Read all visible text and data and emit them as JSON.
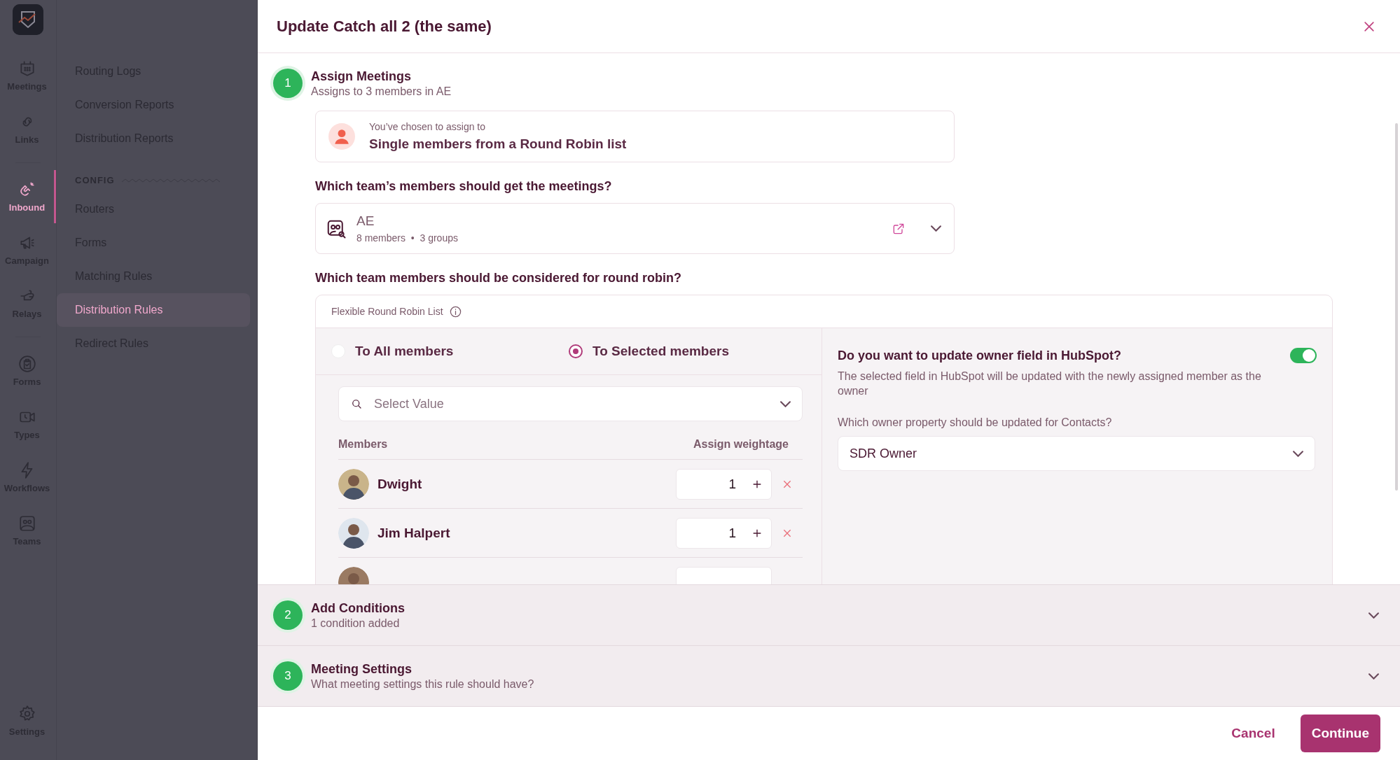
{
  "rail": {
    "groups": [
      [
        {
          "label": "Meetings",
          "kind": "calendar",
          "selected": false
        },
        {
          "label": "Links",
          "kind": "link",
          "selected": false
        }
      ],
      [
        {
          "label": "Inbound",
          "kind": "magnet",
          "selected": true
        },
        {
          "label": "Campaign",
          "kind": "megaphone",
          "selected": false
        },
        {
          "label": "Relays",
          "kind": "hand",
          "selected": false
        }
      ],
      [
        {
          "label": "Forms",
          "kind": "clipboard",
          "selected": false
        },
        {
          "label": "Types",
          "kind": "video",
          "selected": false
        },
        {
          "label": "Workflows",
          "kind": "bolt",
          "selected": false
        },
        {
          "label": "Teams",
          "kind": "people",
          "selected": false
        }
      ]
    ],
    "settings": {
      "label": "Settings"
    }
  },
  "nav": {
    "items": [
      {
        "label": "Routing Logs",
        "selected": false
      },
      {
        "label": "Conversion Reports",
        "selected": false
      },
      {
        "label": "Distribution Reports",
        "selected": false
      }
    ],
    "section_label": "CONFIG",
    "config_items": [
      {
        "label": "Routers",
        "selected": false
      },
      {
        "label": "Forms",
        "selected": false
      },
      {
        "label": "Matching Rules",
        "selected": false
      },
      {
        "label": "Distribution Rules",
        "selected": true
      },
      {
        "label": "Redirect Rules",
        "selected": false
      }
    ]
  },
  "dialog": {
    "title": "Update Catch all 2 (the same)",
    "steps": [
      {
        "number": "1",
        "title": "Assign Meetings",
        "subtitle": "Assigns to 3 members in AE",
        "expanded": true
      },
      {
        "number": "2",
        "title": "Add Conditions",
        "subtitle": "1 condition added",
        "expanded": false
      },
      {
        "number": "3",
        "title": "Meeting Settings",
        "subtitle": "What meeting settings this rule should have?",
        "expanded": false
      }
    ],
    "assign_card": {
      "caption": "You’ve chosen to assign to",
      "value": "Single members from a Round Robin list"
    },
    "team_question": "Which team’s members should get the meetings?",
    "team": {
      "name": "AE",
      "meta": "8 members  •  3 groups"
    },
    "round_robin": {
      "question": "Which team members should be considered for round robin?",
      "list_label": "Flexible Round Robin List",
      "options": [
        {
          "label": "To All members",
          "selected": false
        },
        {
          "label": "To Selected members",
          "selected": true
        }
      ],
      "search": {
        "placeholder": "Select Value"
      },
      "columns": [
        "Members",
        "Assign weightage"
      ],
      "members": [
        {
          "kind": "full",
          "name": "Dwight",
          "weight": "1"
        },
        {
          "kind": "full",
          "name": "Jim Halpert",
          "weight": "1"
        },
        {
          "kind": "partial"
        }
      ]
    },
    "hubspot": {
      "question": "Do you want to update owner field in HubSpot?",
      "on": true,
      "description": "The selected field in HubSpot will be updated with the newly assigned member as the owner",
      "property_label": "Which owner property should be updated for Contacts?",
      "property_value": "SDR Owner"
    },
    "footer": {
      "cancel": "Cancel",
      "continue": "Continue"
    }
  }
}
